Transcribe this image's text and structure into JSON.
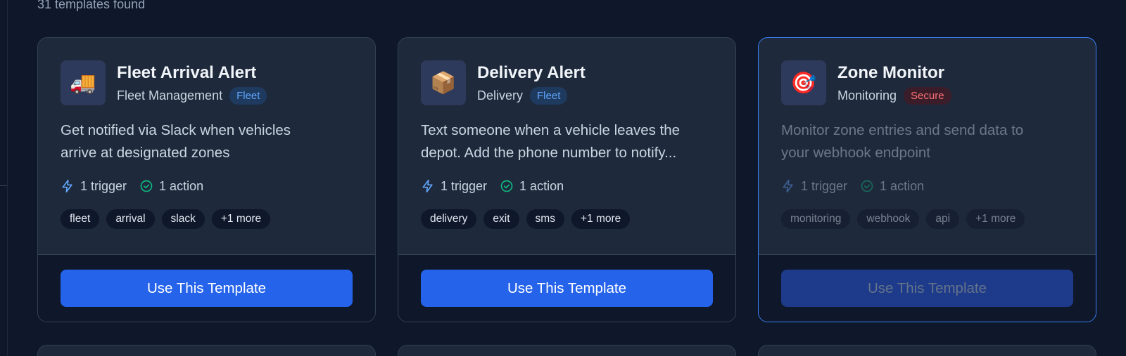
{
  "results": {
    "count_text": "31 templates found"
  },
  "cards": [
    {
      "title": "Fleet Arrival Alert",
      "icon": "truck-icon",
      "icon_glyph": "🚚",
      "category": "Fleet Management",
      "badge": "Fleet",
      "description_line1": "Get notified via Slack when vehicles",
      "description_line2": "arrive at designated zones",
      "triggers": "1 trigger",
      "actions": "1 action",
      "tags": [
        "fleet",
        "arrival",
        "slack",
        "+1 more"
      ],
      "button": "Use This Template"
    },
    {
      "title": "Delivery Alert",
      "icon": "package-icon",
      "icon_glyph": "📦",
      "category": "Delivery",
      "badge": "Fleet",
      "description_line1": "Text someone when a vehicle leaves the",
      "description_line2": "depot. Add the phone number to notify...",
      "triggers": "1 trigger",
      "actions": "1 action",
      "tags": [
        "delivery",
        "exit",
        "sms",
        "+1 more"
      ],
      "button": "Use This Template"
    },
    {
      "title": "Zone Monitor",
      "icon": "target-icon",
      "icon_glyph": "🎯",
      "category": "Monitoring",
      "badge": "Secure",
      "description_line1": "Monitor zone entries and send data to",
      "description_line2": "your webhook endpoint",
      "triggers": "1 trigger",
      "actions": "1 action",
      "tags": [
        "monitoring",
        "webhook",
        "api",
        "+1 more"
      ],
      "button": "Use This Template"
    }
  ],
  "colors": {
    "background": "#0f172a",
    "card": "#1e293b",
    "accent": "#2563eb",
    "fleet_badge": "#60a5fa",
    "secure_badge": "#f87171",
    "trigger_icon": "#60a5fa",
    "action_icon": "#10b981"
  }
}
